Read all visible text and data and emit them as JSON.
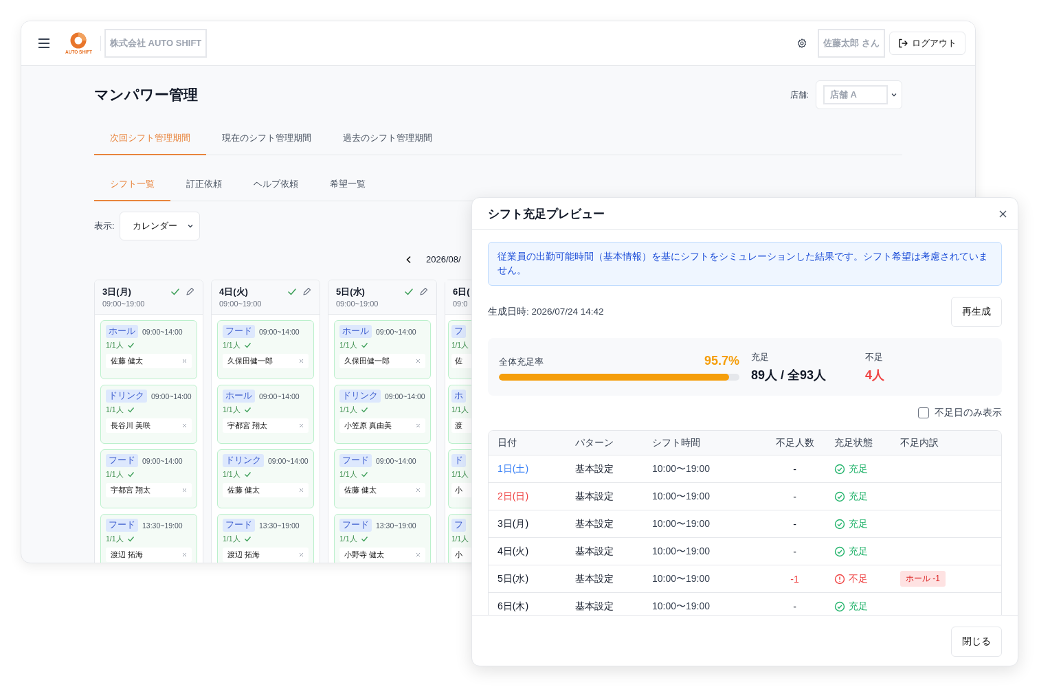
{
  "header": {
    "logo_text": "AUTO SHIFT",
    "company": "株式会社 AUTO SHIFT",
    "user": "佐藤太郎 さん",
    "logout": "ログアウト"
  },
  "page": {
    "title": "マンパワー管理",
    "store_label": "店舗:",
    "store": "店舗 A",
    "period_tabs": [
      {
        "label": "次回シフト管理期間",
        "selected": true
      },
      {
        "label": "現在のシフト管理期間",
        "selected": false
      },
      {
        "label": "過去のシフト管理期間",
        "selected": false
      }
    ],
    "sub_tabs": [
      {
        "label": "シフト一覧",
        "selected": true
      },
      {
        "label": "訂正依頼",
        "selected": false
      },
      {
        "label": "ヘルプ依頼",
        "selected": false
      },
      {
        "label": "希望一覧",
        "selected": false
      }
    ],
    "view_label": "表示:",
    "view": "カレンダー",
    "month": "2026/08/"
  },
  "calendar": {
    "days": [
      {
        "date": "3日(月)",
        "hours": "09:00~19:00",
        "confirmed": true,
        "cards": [
          {
            "tag": "ホール",
            "time": "09:00~14:00",
            "count": "1/1人",
            "filled": true,
            "name": "佐藤 健太"
          },
          {
            "tag": "ドリンク",
            "time": "09:00~14:00",
            "count": "1/1人",
            "filled": true,
            "name": "長谷川 美咲"
          },
          {
            "tag": "フード",
            "time": "09:00~14:00",
            "count": "1/1人",
            "filled": true,
            "name": "宇都宮 翔太"
          },
          {
            "tag": "フード",
            "time": "13:30~19:00",
            "count": "1/1人",
            "filled": true,
            "name": "渡辺 拓海"
          }
        ]
      },
      {
        "date": "4日(火)",
        "hours": "09:00~19:00",
        "confirmed": true,
        "cards": [
          {
            "tag": "フード",
            "time": "09:00~14:00",
            "count": "1/1人",
            "filled": true,
            "name": "久保田健一郎"
          },
          {
            "tag": "ホール",
            "time": "09:00~14:00",
            "count": "1/1人",
            "filled": true,
            "name": "宇都宮 翔太"
          },
          {
            "tag": "ドリンク",
            "time": "09:00~14:00",
            "count": "1/1人",
            "filled": true,
            "name": "佐藤 健太"
          },
          {
            "tag": "フード",
            "time": "13:30~19:00",
            "count": "1/1人",
            "filled": true,
            "name": "渡辺 拓海"
          }
        ]
      },
      {
        "date": "5日(水)",
        "hours": "09:00~19:00",
        "confirmed": true,
        "cards": [
          {
            "tag": "ホール",
            "time": "09:00~14:00",
            "count": "1/1人",
            "filled": true,
            "name": "久保田健一郎"
          },
          {
            "tag": "ドリンク",
            "time": "09:00~14:00",
            "count": "1/1人",
            "filled": true,
            "name": "小笠原 真由美"
          },
          {
            "tag": "フード",
            "time": "09:00~14:00",
            "count": "1/1人",
            "filled": true,
            "name": "佐藤 健太"
          },
          {
            "tag": "フード",
            "time": "13:30~19:00",
            "count": "1/1人",
            "filled": true,
            "name": "小野寺 健太"
          }
        ]
      },
      {
        "date": "6日(",
        "hours": "09:0",
        "cards": [
          {
            "tag": "フ",
            "count": "1/1人",
            "name": "佐"
          },
          {
            "tag": "ホ",
            "count": "1/1人",
            "name": "渡"
          },
          {
            "tag": "ド",
            "count": "1/1人",
            "name": "小"
          },
          {
            "tag": "フ",
            "count": "1/1人",
            "name": "小"
          }
        ]
      }
    ]
  },
  "modal": {
    "title": "シフト充足プレビュー",
    "notice": "従業員の出勤可能時間（基本情報）を基にシフトをシミュレーションした結果です。シフト希望は考慮されていません。",
    "generated": "生成日時: 2026/07/24 14:42",
    "regenerate": "再生成",
    "stats": {
      "rate_label": "全体充足率",
      "rate": "95.7%",
      "level": 0.957,
      "filled_label": "充足",
      "filled": "89人 / 全93人",
      "short_label": "不足",
      "short": "4人"
    },
    "filter": {
      "label": "不足日のみ表示",
      "checked": false
    },
    "columns": [
      "日付",
      "パターン",
      "シフト時間",
      "不足人数",
      "充足状態",
      "不足内訳"
    ],
    "rows": [
      {
        "date": "1日(土)",
        "kind": "saturday",
        "pattern": "基本設定",
        "time": "10:00〜19:00",
        "shortage": "-",
        "short": false,
        "status_text": "充足"
      },
      {
        "date": "2日(日)",
        "kind": "sunday",
        "pattern": "基本設定",
        "time": "10:00〜19:00",
        "shortage": "-",
        "short": false,
        "status_text": "充足"
      },
      {
        "date": "3日(月)",
        "kind": "weekday",
        "pattern": "基本設定",
        "time": "10:00〜19:00",
        "shortage": "-",
        "short": false,
        "status_text": "充足"
      },
      {
        "date": "4日(火)",
        "kind": "weekday",
        "pattern": "基本設定",
        "time": "10:00〜19:00",
        "shortage": "-",
        "short": false,
        "status_text": "充足"
      },
      {
        "date": "5日(水)",
        "kind": "weekday",
        "pattern": "基本設定",
        "time": "10:00〜19:00",
        "shortage": "-1",
        "short": true,
        "status_text": "不足",
        "breakdown": "ホール -1"
      },
      {
        "date": "6日(木)",
        "kind": "weekday",
        "pattern": "基本設定",
        "time": "10:00〜19:00",
        "shortage": "-",
        "short": false,
        "status_text": "充足"
      }
    ],
    "close": "閉じる"
  }
}
